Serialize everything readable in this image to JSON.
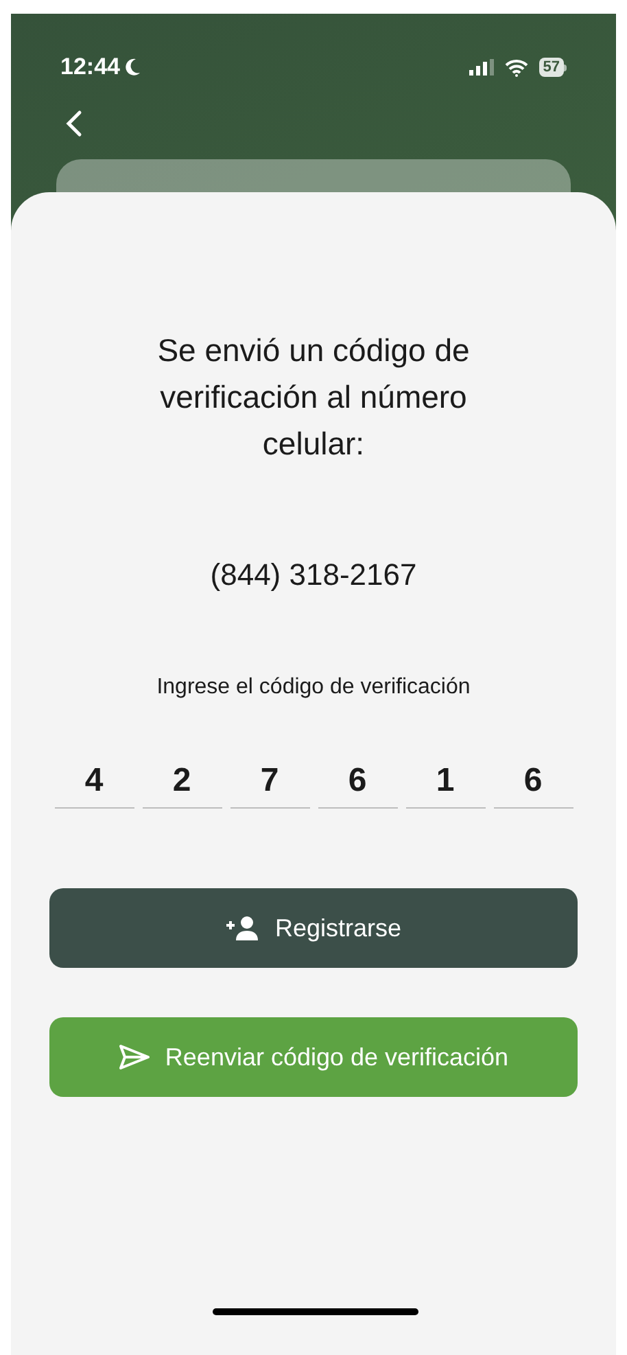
{
  "status_bar": {
    "time": "12:44",
    "battery": "57"
  },
  "message": "Se envió un código de verificación al número celular:",
  "phone": "(844) 318-2167",
  "instruction": "Ingrese el código de verificación",
  "code_digits": [
    "4",
    "2",
    "7",
    "6",
    "1",
    "6"
  ],
  "buttons": [
    {
      "kind": "register",
      "label": "Registrarse"
    },
    {
      "kind": "resend",
      "label": "Reenviar código de verificación"
    }
  ]
}
